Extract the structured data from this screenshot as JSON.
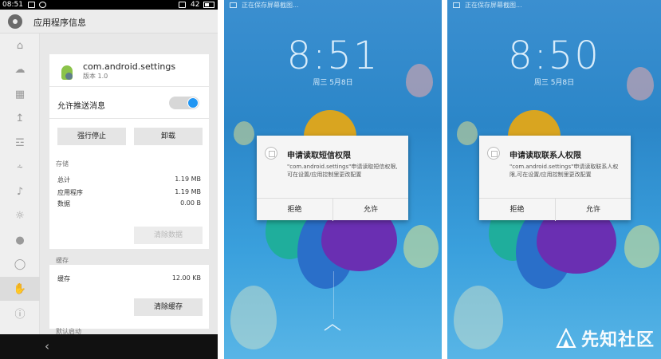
{
  "settings_panel": {
    "status_time": "08:51",
    "status_battery": "42",
    "title": "应用程序信息",
    "app_name": "com.android.settings",
    "app_version": "版本 1.0",
    "push_label": "允许推送消息",
    "push_enabled": true,
    "force_stop_label": "强行停止",
    "uninstall_label": "卸载",
    "storage_header": "存储",
    "storage_rows": [
      {
        "label": "总计",
        "value": "1.19 MB"
      },
      {
        "label": "应用程序",
        "value": "1.19 MB"
      },
      {
        "label": "数据",
        "value": "0.00 B"
      }
    ],
    "clear_data_label": "清除数据",
    "cache_header": "缓存",
    "cache_label": "缓存",
    "cache_value": "12.00 KB",
    "clear_cache_label": "清除缓存",
    "default_launch_header": "默认启动",
    "rail_icons": [
      "home-icon",
      "cloud-icon",
      "grid-icon",
      "signal-icon",
      "wifi-icon",
      "bluetooth-icon",
      "volume-icon",
      "brightness-icon",
      "lock-location-icon",
      "globe-icon",
      "hand-icon",
      "info-icon"
    ]
  },
  "lock_screens": [
    {
      "status_text": "正在保存屏幕截图...",
      "time": "8:51",
      "date": "周三 5月8日",
      "dialog_title": "申请读取短信权限",
      "dialog_message": "\"com.android.settings\"申请读取短信权限,可在设置/应用控制里更改配置",
      "deny_label": "拒绝",
      "allow_label": "允许"
    },
    {
      "status_text": "正在保存屏幕截图...",
      "time": "8:50",
      "date": "周三 5月8日",
      "dialog_title": "申请读取联系人权限",
      "dialog_message": "\"com.android.settings\"申请读取联系人权限,可在设置/应用控制里更改配置",
      "deny_label": "拒绝",
      "allow_label": "允许"
    }
  ],
  "watermark_text": "先知社区",
  "colors": {
    "toggle_on": "#2196f3",
    "lock_bg": "#2b86c8",
    "android_green": "#8bc34a"
  }
}
